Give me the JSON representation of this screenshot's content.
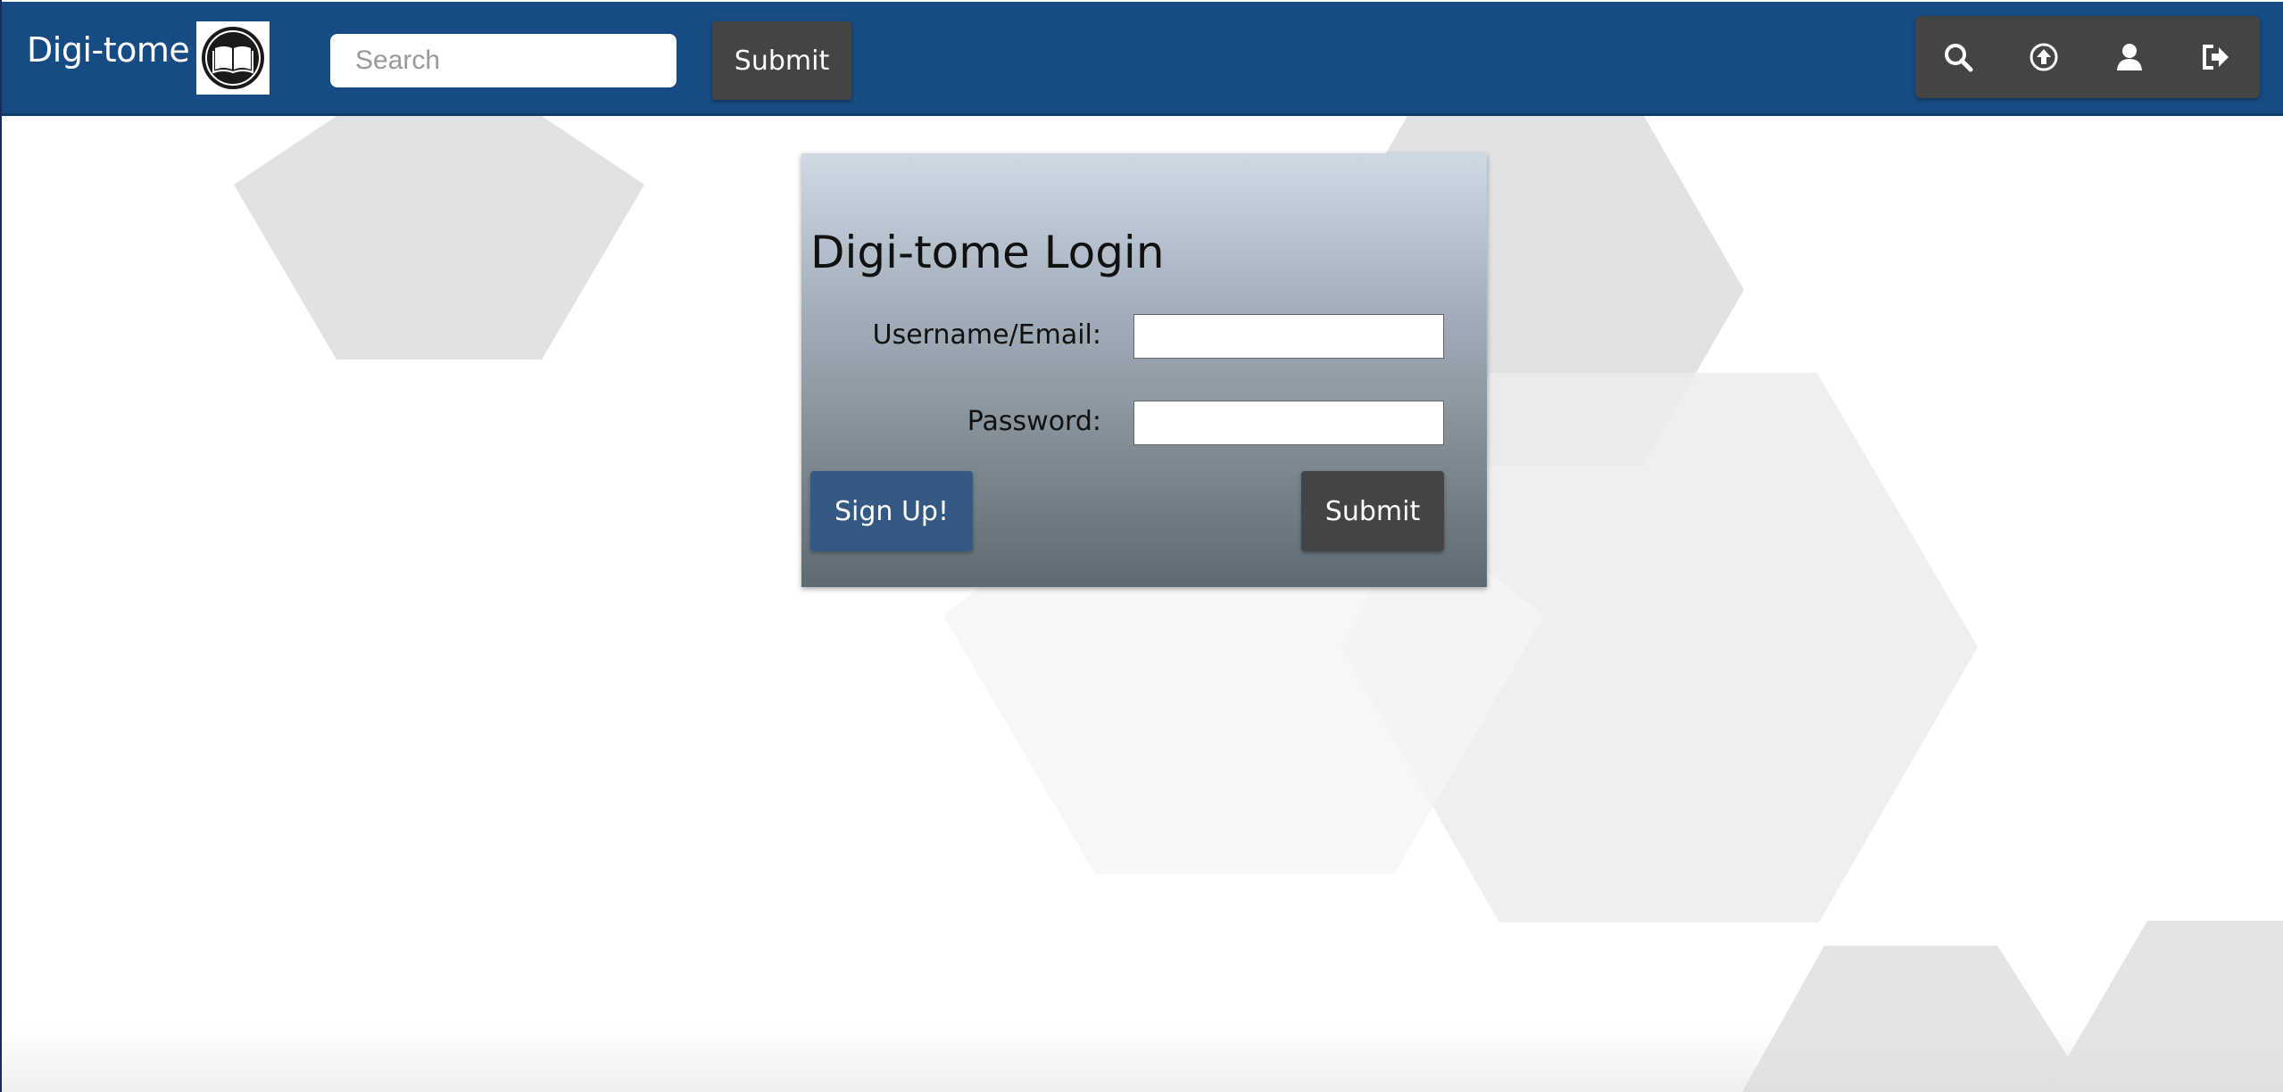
{
  "header": {
    "brand": "Digi-tome",
    "logo_icon": "open-book-icon",
    "search_placeholder": "Search",
    "search_value": "",
    "submit_label": "Submit",
    "icons": [
      "search-icon",
      "upload-icon",
      "user-icon",
      "logout-icon"
    ]
  },
  "login": {
    "title": "Digi-tome Login",
    "username_label": "Username/Email:",
    "username_value": "",
    "password_label": "Password:",
    "password_value": "",
    "signup_label": "Sign Up!",
    "submit_label": "Submit"
  },
  "colors": {
    "navbar": "#174b84",
    "button_dark": "#444444",
    "signup": "#345a84"
  }
}
